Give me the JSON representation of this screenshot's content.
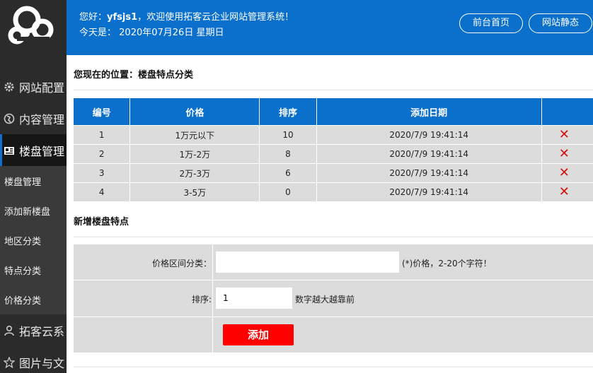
{
  "header": {
    "greeting_prefix": "您好：",
    "username": "yfsjs1",
    "greeting_suffix": "，欢迎使用拓客云企业网站管理系统！",
    "today_label": "今天是：",
    "date": "2020年07月26日",
    "weekday": "星期日",
    "buttons": [
      "前台首页",
      "网站静态"
    ]
  },
  "sidebar": {
    "menu": [
      {
        "label": "网站配置",
        "icon": "gear-icon"
      },
      {
        "label": "内容管理",
        "icon": "globe-icon"
      },
      {
        "label": "楼盘管理",
        "icon": "building-icon",
        "active": true
      }
    ],
    "submenu": [
      "楼盘管理",
      "添加新楼盘",
      "地区分类",
      "特点分类",
      "价格分类"
    ],
    "menu_bottom": [
      {
        "label": "拓客云系",
        "icon": "user-icon"
      },
      {
        "label": "图片与文",
        "icon": "star-icon"
      }
    ]
  },
  "breadcrumb": "您现在的位置：楼盘特点分类",
  "table": {
    "columns": [
      "编号",
      "价格",
      "排序",
      "添加日期",
      "管"
    ],
    "rows": [
      {
        "id": "1",
        "price": "1万元以下",
        "order": "10",
        "date": "2020/7/9 19:41:14"
      },
      {
        "id": "2",
        "price": "1万-2万",
        "order": "8",
        "date": "2020/7/9 19:41:14"
      },
      {
        "id": "3",
        "price": "2万-3万",
        "order": "6",
        "date": "2020/7/9 19:41:14"
      },
      {
        "id": "4",
        "price": "3-5万",
        "order": "0",
        "date": "2020/7/9 19:41:14"
      }
    ],
    "delete_symbol": "✕"
  },
  "form": {
    "title": "新增楼盘特点",
    "price_label": "价格区间分类：",
    "price_value": "",
    "price_hint": "(*)价格，2-20个字符！",
    "order_label": "排序:",
    "order_value": "1",
    "order_hint": "数字越大越靠前",
    "submit_label": "添加"
  },
  "colors": {
    "brand_blue": "#0b6fcc",
    "sidebar_bg": "#2b2b2b",
    "delete_red": "#d21010",
    "submit_red": "#ff0000"
  }
}
